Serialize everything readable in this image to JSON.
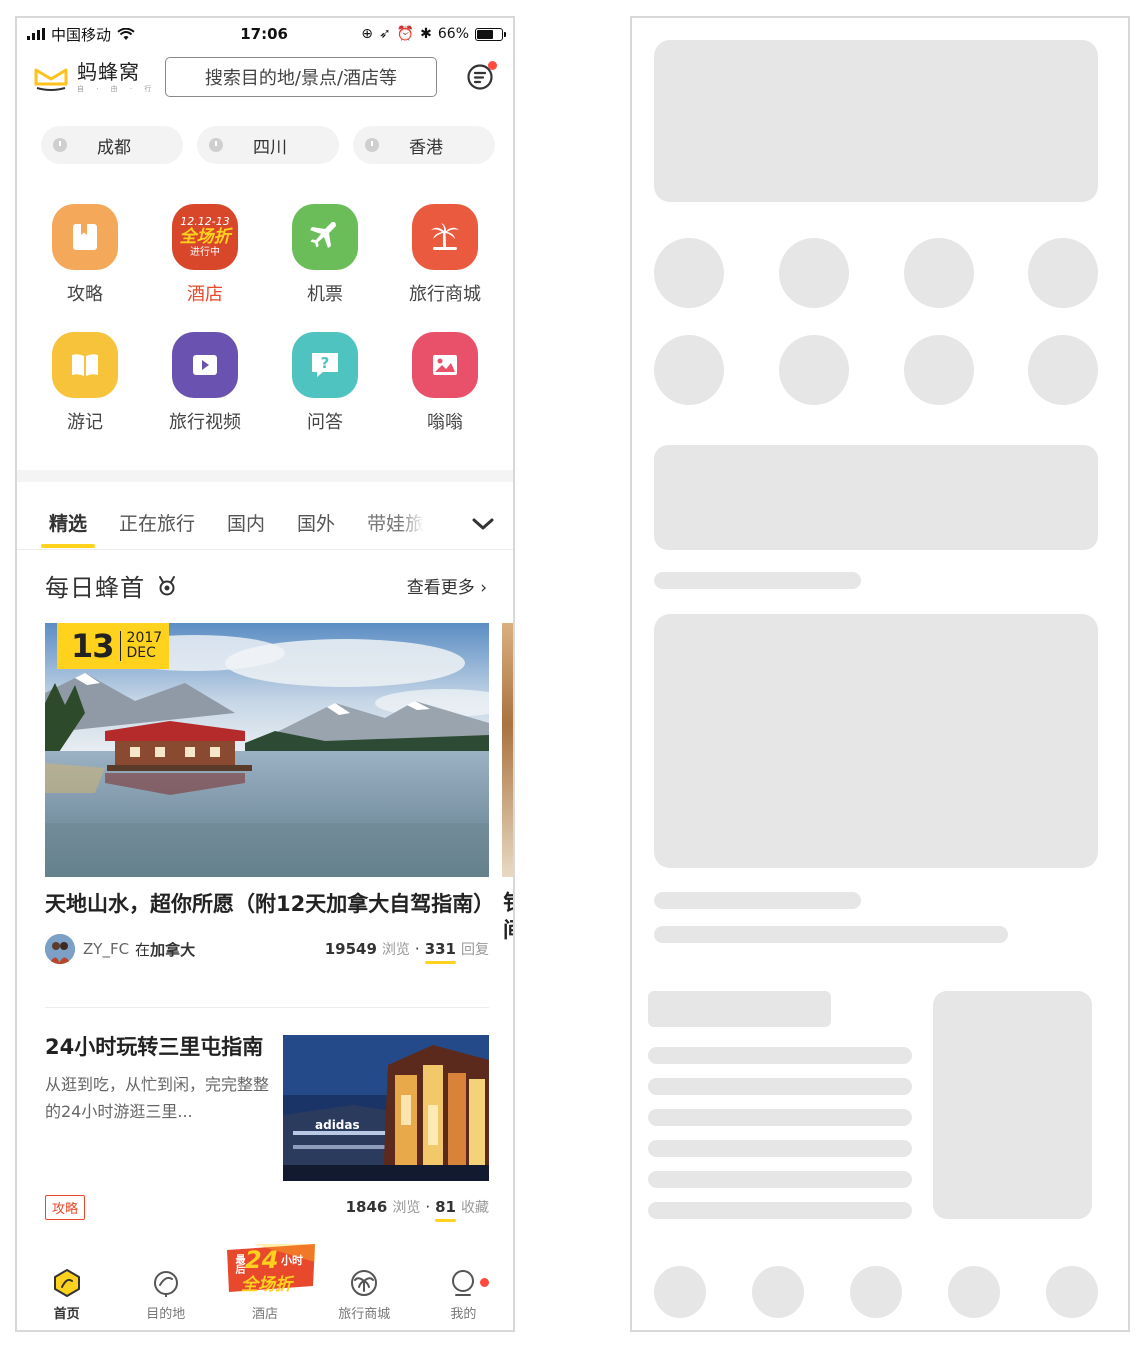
{
  "status_bar": {
    "carrier": "中国移动",
    "time": "17:06",
    "battery": "66%",
    "battery_level": 0.66
  },
  "header": {
    "logo_text": "蚂蜂窝",
    "logo_sub": "自 · 由 · 行",
    "search_placeholder": "搜索目的地/景点/酒店等"
  },
  "history": [
    "成都",
    "四川",
    "香港"
  ],
  "grid": [
    {
      "label": "攻略",
      "icon": "guide-icon",
      "color": "#f4a85a"
    },
    {
      "label": "酒店",
      "icon": "hotel-promo-icon",
      "color": "#d9472b",
      "hot": true,
      "badge_top": "12.12-13",
      "badge_mid": "全场折",
      "badge_bot": "进行中"
    },
    {
      "label": "机票",
      "icon": "plane-icon",
      "color": "#6bbd5a"
    },
    {
      "label": "旅行商城",
      "icon": "palm-tree-icon",
      "color": "#ea5a3e"
    },
    {
      "label": "游记",
      "icon": "book-icon",
      "color": "#f6c33b"
    },
    {
      "label": "旅行视频",
      "icon": "video-icon",
      "color": "#6a52b0"
    },
    {
      "label": "问答",
      "icon": "question-icon",
      "color": "#4fc3c0"
    },
    {
      "label": "嗡嗡",
      "icon": "photo-icon",
      "color": "#e9506a"
    }
  ],
  "tabs": [
    "精选",
    "正在旅行",
    "国内",
    "国外",
    "带娃旅"
  ],
  "section": {
    "title": "每日蜂首",
    "more": "查看更多"
  },
  "feature": {
    "day": "13",
    "year": "2017",
    "month": "DEC",
    "title": "天地山水，超你所愿（附12天加拿大自驾指南）",
    "author": "ZY_FC",
    "loc_prefix": "在",
    "loc": "加拿大",
    "views": "19549",
    "views_unit": "浏览",
    "dot": "·",
    "replies": "331",
    "replies_unit": "回复",
    "next_title_peek": "钅\n间"
  },
  "article": {
    "title": "24小时玩转三里屯指南",
    "desc": "从逛到吃，从忙到闲，完完整整的24小时游逛三里...",
    "tag": "攻略",
    "views": "1846",
    "views_unit": "浏览",
    "dot": "·",
    "favs": "81",
    "favs_unit": "收藏"
  },
  "tabbar": [
    {
      "label": "首页",
      "active": true
    },
    {
      "label": "目的地"
    },
    {
      "label": "酒店"
    },
    {
      "label": "旅行商城"
    },
    {
      "label": "我的"
    }
  ],
  "promo": {
    "top": "最后",
    "num": "24",
    "unit": "小时",
    "text": "全场折"
  }
}
